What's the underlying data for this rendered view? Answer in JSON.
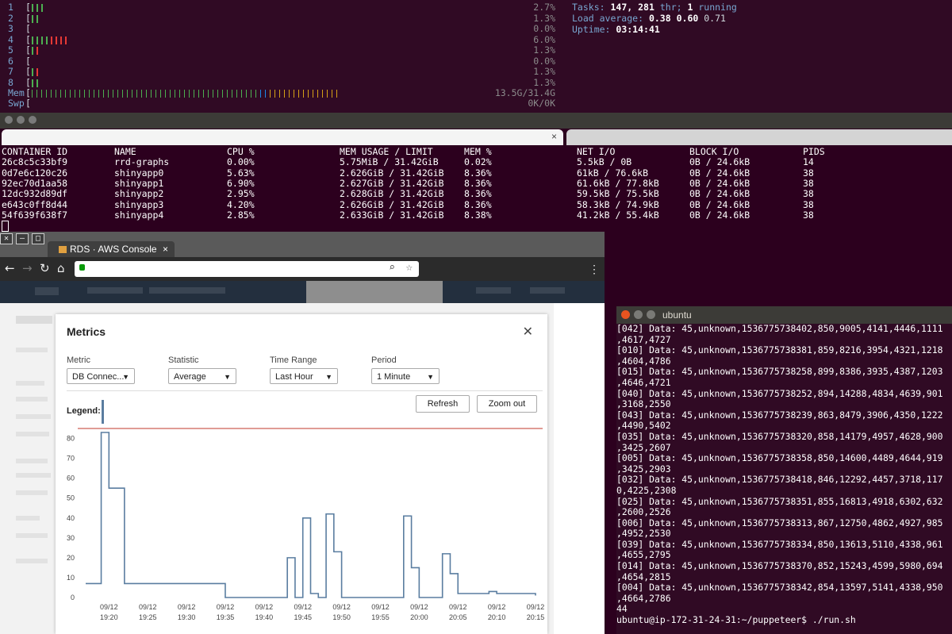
{
  "htop": {
    "cpus": [
      {
        "num": "1",
        "pct": "2.7%",
        "green": 3,
        "red": 0
      },
      {
        "num": "2",
        "pct": "1.3%",
        "green": 2,
        "red": 0
      },
      {
        "num": "3",
        "pct": "0.0%",
        "green": 0,
        "red": 0
      },
      {
        "num": "4",
        "pct": "6.0%",
        "green": 4,
        "red": 4
      },
      {
        "num": "5",
        "pct": "1.3%",
        "green": 1,
        "red": 1
      },
      {
        "num": "6",
        "pct": "0.0%",
        "green": 0,
        "red": 0
      },
      {
        "num": "7",
        "pct": "1.3%",
        "green": 1,
        "red": 1
      },
      {
        "num": "8",
        "pct": "1.3%",
        "green": 2,
        "red": 0
      }
    ],
    "mem_label": "Mem",
    "mem_value": "13.5G/31.4G",
    "swp_label": "Swp",
    "swp_value": "0K/0K",
    "tasks_label": "Tasks:",
    "tasks_count": "147,",
    "threads": "281",
    "thr_label": "thr;",
    "running": "1",
    "running_label": "running",
    "load_label": "Load average:",
    "load1": "0.38",
    "load5": "0.60",
    "load15": "0.71",
    "uptime_label": "Uptime:",
    "uptime": "03:14:41"
  },
  "docker": {
    "headers": [
      "CONTAINER ID",
      "NAME",
      "CPU %",
      "MEM USAGE / LIMIT",
      "MEM %",
      "NET I/O",
      "BLOCK I/O",
      "PIDS"
    ],
    "rows": [
      [
        "26c8c5c33bf9",
        "rrd-graphs",
        "0.00%",
        "5.75MiB / 31.42GiB",
        "0.02%",
        "5.5kB / 0B",
        "0B / 24.6kB",
        "14"
      ],
      [
        "0d7e6c120c26",
        "shinyapp0",
        "5.63%",
        "2.626GiB / 31.42GiB",
        "8.36%",
        "61kB / 76.6kB",
        "0B / 24.6kB",
        "38"
      ],
      [
        "92ec70d1aa58",
        "shinyapp1",
        "6.90%",
        "2.627GiB / 31.42GiB",
        "8.36%",
        "61.6kB / 77.8kB",
        "0B / 24.6kB",
        "38"
      ],
      [
        "12dc932d89df",
        "shinyapp2",
        "2.95%",
        "2.628GiB / 31.42GiB",
        "8.36%",
        "59.5kB / 75.5kB",
        "0B / 24.6kB",
        "38"
      ],
      [
        "e643c0ff8d44",
        "shinyapp3",
        "4.20%",
        "2.626GiB / 31.42GiB",
        "8.36%",
        "58.3kB / 74.9kB",
        "0B / 24.6kB",
        "38"
      ],
      [
        "54f639f638f7",
        "shinyapp4",
        "2.85%",
        "2.633GiB / 31.42GiB",
        "8.38%",
        "41.2kB / 55.4kB",
        "0B / 24.6kB",
        "38"
      ]
    ]
  },
  "browser": {
    "tab_title": "RDS · AWS Console",
    "tab_close": "×",
    "light_tab_close": "×"
  },
  "modal": {
    "title": "Metrics",
    "close": "✕",
    "metric_label": "Metric",
    "metric_value": "DB Connec...",
    "statistic_label": "Statistic",
    "statistic_value": "Average",
    "timerange_label": "Time Range",
    "timerange_value": "Last Hour",
    "period_label": "Period",
    "period_value": "1 Minute",
    "legend_label": "Legend:",
    "refresh": "Refresh",
    "zoomout": "Zoom out"
  },
  "chart_data": {
    "type": "line",
    "title": "",
    "xlabel": "",
    "ylabel": "",
    "ylim": [
      0,
      85
    ],
    "yticks": [
      0,
      10,
      20,
      30,
      40,
      50,
      60,
      70,
      80
    ],
    "xtick_dates": [
      "09/12",
      "09/12",
      "09/12",
      "09/12",
      "09/12",
      "09/12",
      "09/12",
      "09/12",
      "09/12",
      "09/12",
      "09/12",
      "09/12"
    ],
    "xtick_times": [
      "19:20",
      "19:25",
      "19:30",
      "19:35",
      "19:40",
      "19:45",
      "19:50",
      "19:55",
      "20:00",
      "20:05",
      "20:10",
      "20:15"
    ],
    "step": true,
    "x_minutes": [
      17,
      19,
      20,
      21,
      22,
      23,
      24,
      25,
      26,
      27,
      28,
      29,
      30,
      31,
      32,
      33,
      34,
      35,
      36,
      37,
      38,
      39,
      40,
      41,
      42,
      43,
      44,
      45,
      46,
      47,
      48,
      49,
      50,
      51,
      52,
      53,
      54,
      55,
      56,
      57,
      58,
      59,
      60,
      61,
      62,
      63,
      64,
      65,
      66,
      67,
      68,
      69,
      70,
      71,
      72,
      73,
      74,
      75
    ],
    "values": [
      7,
      83,
      55,
      55,
      7,
      7,
      7,
      7,
      7,
      7,
      7,
      7,
      7,
      7,
      7,
      7,
      7,
      0,
      0,
      0,
      0,
      0,
      0,
      0,
      0,
      20,
      0,
      40,
      2,
      0,
      42,
      23,
      0,
      0,
      0,
      0,
      0,
      0,
      0,
      0,
      41,
      15,
      0,
      0,
      0,
      22,
      12,
      2,
      2,
      2,
      2,
      3,
      2,
      2,
      2,
      2,
      2,
      1,
      0
    ]
  },
  "terminal": {
    "title": "ubuntu",
    "lines": [
      "[042] Data: 45,unknown,1536775738402,850,9005,4141,4446,1111",
      ",4617,4727",
      "[010] Data: 45,unknown,1536775738381,859,8216,3954,4321,1218",
      ",4604,4786",
      "[015] Data: 45,unknown,1536775738258,899,8386,3935,4387,1203",
      ",4646,4721",
      "[040] Data: 45,unknown,1536775738252,894,14288,4834,4639,901",
      ",3168,2550",
      "[043] Data: 45,unknown,1536775738239,863,8479,3906,4350,1222",
      ",4490,5402",
      "[035] Data: 45,unknown,1536775738320,858,14179,4957,4628,900",
      ",3425,2607",
      "[005] Data: 45,unknown,1536775738358,850,14600,4489,4644,919",
      ",3425,2903",
      "[032] Data: 45,unknown,1536775738418,846,12292,4457,3718,117",
      "0,4225,2308",
      "[025] Data: 45,unknown,1536775738351,855,16813,4918,6302,632",
      ",2600,2526",
      "[006] Data: 45,unknown,1536775738313,867,12750,4862,4927,985",
      ",4952,2530",
      "[039] Data: 45,unknown,1536775738334,850,13613,5110,4338,961",
      ",4655,2795",
      "[014] Data: 45,unknown,1536775738370,852,15243,4599,5980,694",
      ",4654,2815",
      "[004] Data: 45,unknown,1536775738342,854,13597,5141,4338,950",
      ",4664,2786",
      "44",
      "ubuntu@ip-172-31-24-31:~/puppeteer$ ./run.sh"
    ]
  },
  "colors": {
    "terminal_bg": "#300a24",
    "htop_blue": "#78a6d0",
    "bar_green": "#4caf50",
    "bar_red": "#e53935",
    "chart_line": "#5a7da0",
    "chart_ref_line": "#c0392b"
  }
}
